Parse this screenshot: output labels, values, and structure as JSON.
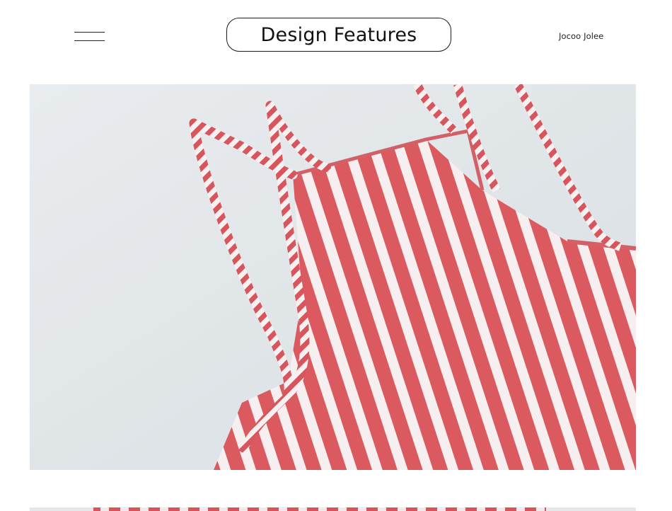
{
  "header": {
    "menu_icon": "hamburger-lines-icon",
    "title": "Design Features",
    "brand": "Jocoo Jolee"
  },
  "images": [
    {
      "depicts": "red-white-striped-camisole-strap-detail"
    },
    {
      "depicts": "red-white-striped-fabric-partial"
    }
  ],
  "colors": {
    "background": "#ffffff",
    "photo_background": "#dde3e7",
    "stripe_red": "#d9545a",
    "stripe_white": "#f7eef0"
  }
}
